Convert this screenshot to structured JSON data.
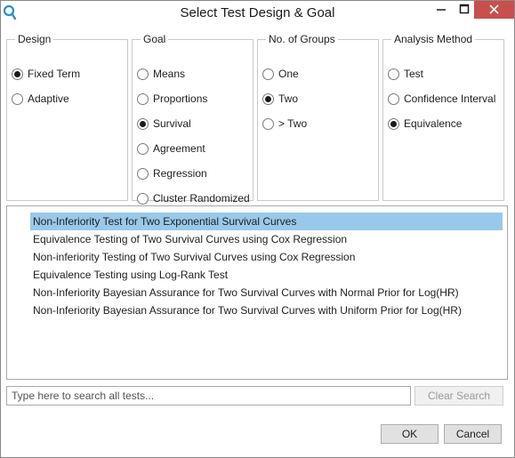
{
  "window": {
    "title": "Select Test Design & Goal",
    "icons": {
      "app": "magnifier-app-icon",
      "minimize": "minimize-icon",
      "maximize": "maximize-icon",
      "close": "close-icon"
    },
    "colors": {
      "close_button": "#c7504c",
      "selection": "#99c9ea"
    }
  },
  "groups": {
    "design": {
      "legend": "Design",
      "options": [
        {
          "label": "Fixed Term",
          "checked": true
        },
        {
          "label": "Adaptive",
          "checked": false
        }
      ]
    },
    "goal": {
      "legend": "Goal",
      "options": [
        {
          "label": "Means",
          "checked": false
        },
        {
          "label": "Proportions",
          "checked": false
        },
        {
          "label": "Survival",
          "checked": true
        },
        {
          "label": "Agreement",
          "checked": false
        },
        {
          "label": "Regression",
          "checked": false
        },
        {
          "label": "Cluster Randomized",
          "checked": false
        }
      ]
    },
    "groups_count": {
      "legend": "No. of Groups",
      "options": [
        {
          "label": "One",
          "checked": false
        },
        {
          "label": "Two",
          "checked": true
        },
        {
          "label": "> Two",
          "checked": false
        }
      ]
    },
    "method": {
      "legend": "Analysis Method",
      "options": [
        {
          "label": "Test",
          "checked": false
        },
        {
          "label": "Confidence Interval",
          "checked": false
        },
        {
          "label": "Equivalence",
          "checked": true
        }
      ]
    }
  },
  "tests": {
    "selected_index": 0,
    "items": [
      "Non-Inferiority Test for Two Exponential Survival Curves",
      "Equivalence Testing of Two Survival Curves using Cox Regression",
      "Non-inferiority Testing of Two Survival Curves using Cox Regression",
      "Equivalence Testing using Log-Rank Test",
      "Non-Inferiority Bayesian Assurance for Two Survival Curves with Normal Prior for Log(HR)",
      "Non-Inferiority Bayesian Assurance for Two Survival Curves with Uniform Prior for Log(HR)"
    ]
  },
  "search": {
    "placeholder": "Type here to search all tests...",
    "value": "",
    "clear_label": "Clear Search"
  },
  "buttons": {
    "ok": "OK",
    "cancel": "Cancel"
  }
}
